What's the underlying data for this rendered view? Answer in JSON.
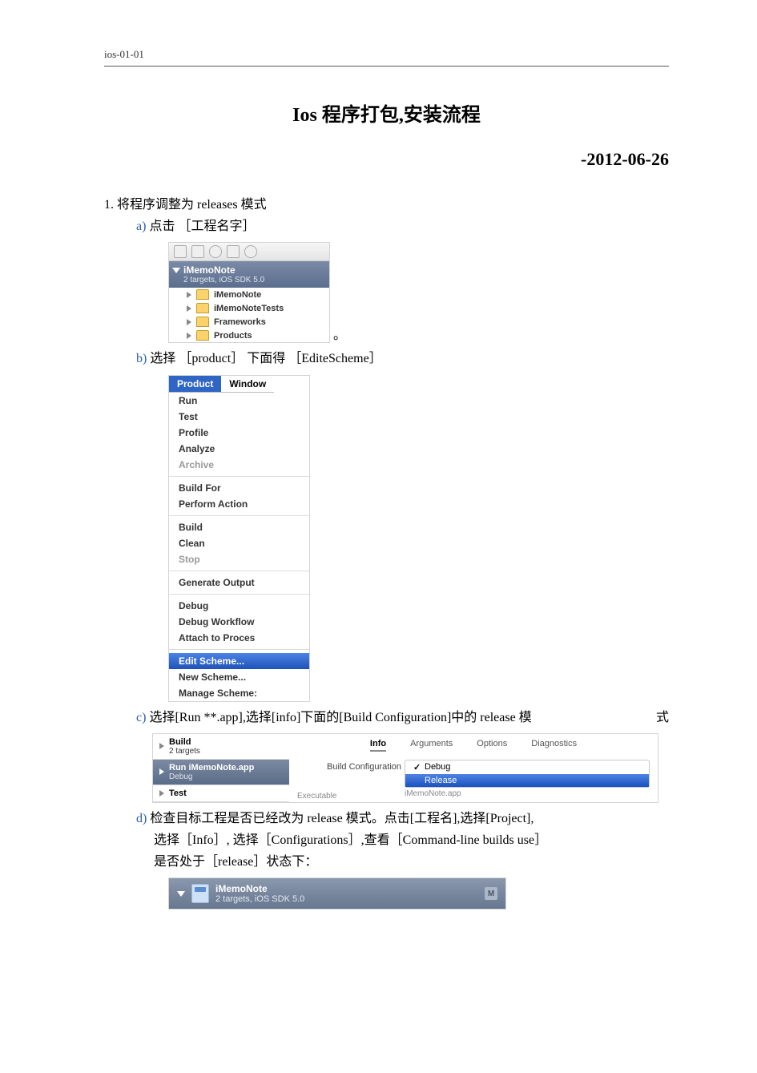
{
  "header_id": "ios-01-01",
  "title": "Ios 程序打包,安装流程",
  "date": "-2012-06-26",
  "step1": {
    "num": "1.",
    "text": "将程序调整为 releases 模式",
    "a": {
      "label": "a)",
      "text_pre": "点击",
      "bracket": "［工程名字］"
    },
    "b": {
      "label": "b)",
      "text_pre": "选择",
      "br1": "［product］",
      "mid": "下面得",
      "br2": "［EditeScheme］"
    },
    "c": {
      "label": "c)",
      "line": "选择[Run **.app],选择[info]下面的[Build  Configuration]中的 release 模",
      "line_end": "式"
    },
    "d": {
      "label": "d)",
      "line1": "检查目标工程是否已经改为 release 模式。点击[工程名],选择[Project],",
      "line2": "选择［Info］, 选择［Configurations］,查看［Command-line builds use］",
      "line3": "是否处于［release］状态下："
    }
  },
  "shotA": {
    "proj_name": "iMemoNote",
    "proj_sub": "2 targets, iOS SDK 5.0",
    "folders": [
      "iMemoNote",
      "iMemoNoteTests",
      "Frameworks",
      "Products"
    ]
  },
  "shotB": {
    "menubar": [
      "Product",
      "Window"
    ],
    "groups": [
      [
        "Run",
        "Test",
        "Profile",
        "Analyze",
        "Archive"
      ],
      [
        "Build For",
        "Perform Action"
      ],
      [
        "Build",
        "Clean",
        "Stop"
      ],
      [
        "Generate Output"
      ],
      [
        "Debug",
        "Debug Workflow",
        "Attach to Proces"
      ],
      [
        "Edit Scheme...",
        "New Scheme...",
        "Manage Scheme:"
      ]
    ],
    "disabled": [
      "Archive",
      "Stop"
    ],
    "highlighted": "Edit Scheme..."
  },
  "shotC": {
    "side": [
      {
        "t": "Build",
        "s": "2 targets"
      },
      {
        "t": "Run iMemoNote.app",
        "s": "Debug",
        "sel": true
      },
      {
        "t": "Test",
        "s": ""
      }
    ],
    "tabs": [
      "Info",
      "Arguments",
      "Options",
      "Diagnostics"
    ],
    "active_tab": "Info",
    "conf_label": "Build Configuration",
    "options": [
      {
        "label": "Debug",
        "checked": true
      },
      {
        "label": "Release",
        "sel": true
      }
    ],
    "exec_hint_l": "Executable",
    "exec_hint_r": "iMemoNote.app"
  },
  "shotD": {
    "name": "iMemoNote",
    "sub": "2 targets, iOS SDK 5.0",
    "badge": "M"
  }
}
